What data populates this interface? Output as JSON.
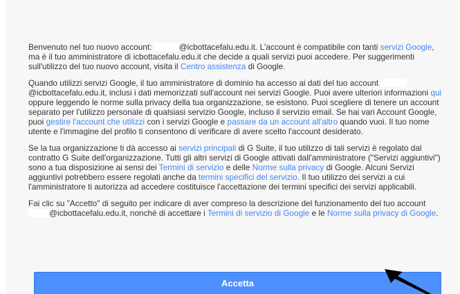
{
  "intro": {
    "p1": "Benvenuto nel tuo nuovo account: ",
    "p2": "@icbottacefalu.edu.it. L'account è compatibile con tanti ",
    "link_servizi_google": "servizi Google",
    "p3": ", ma è il tuo amministratore di icbottacefalu.edu.it che decide a quali servizi puoi accedere. Per suggerimenti sull'utilizzo del tuo nuovo account, visita il ",
    "link_centro_assistenza": "Centro assistenza",
    "p4": " di Google."
  },
  "admin_access": {
    "p1": "Quando utilizzi servizi Google, il tuo amministratore di dominio ha accesso ai dati del tuo account ",
    "p2": "@icbottacefalu.edu.it, inclusi i dati memorizzati sull'account nei servizi Google. Puoi avere ulteriori informazioni ",
    "link_qui": "qui",
    "p3": " oppure leggendo le norme sulla privacy della tua organizzazione, se esistono. Puoi scegliere di tenere un account separato per l'utilizzo personale di qualsiasi servizio Google, incluso il servizio email. Se hai vari Account Google, puoi ",
    "link_gestire": "gestire l'account che utilizzi",
    "p4": " con i servizi Google e ",
    "link_passare": "passare da un account all'altro",
    "p5": " quando vuoi. Il tuo nome utente e l'immagine del profilo ti consentono di verificare di avere scelto l'account desiderato."
  },
  "services": {
    "p1": "Se la tua organizzazione ti dà accesso ai ",
    "link_servizi_principali": "servizi principali",
    "p2": " di G Suite, il tuo utilizzo di tali servizi è regolato dal contratto G Suite dell'organizzazione. Tutti gli altri servizi di Google attivati dall'amministratore (\"Servizi aggiuntivi\") sono a tua disposizione ai sensi dei ",
    "link_termini": "Termini di servizio",
    "p3": " e delle ",
    "link_norme": "Norme sulla privacy",
    "p4": " di Google. Alcuni Servizi aggiuntivi potrebbero essere regolati anche da ",
    "link_termini_specifici": "termini specifici del servizio.",
    "p5": " Il tuo utilizzo dei servizi a cui l'amministratore ti autorizza ad accedere costituisce l'accettazione dei termini specifici dei servizi applicabili."
  },
  "consent": {
    "p1": "Fai clic su \"Accetto\" di seguito per indicare di aver compreso la descrizione del funzionamento del tuo account ",
    "p2": "@icbottacefalu.edu.it, nonché di accettare i ",
    "link_termini_google": "Termini di servizio di Google",
    "p3": " e le ",
    "link_norme_google": "Norme sulla privacy di Google",
    "p4": "."
  },
  "accept_button": {
    "label": "Accetta"
  },
  "colors": {
    "link": "#4285f4",
    "button": "#4d90fe",
    "text": "#333333",
    "background": "#f7f7f7"
  }
}
